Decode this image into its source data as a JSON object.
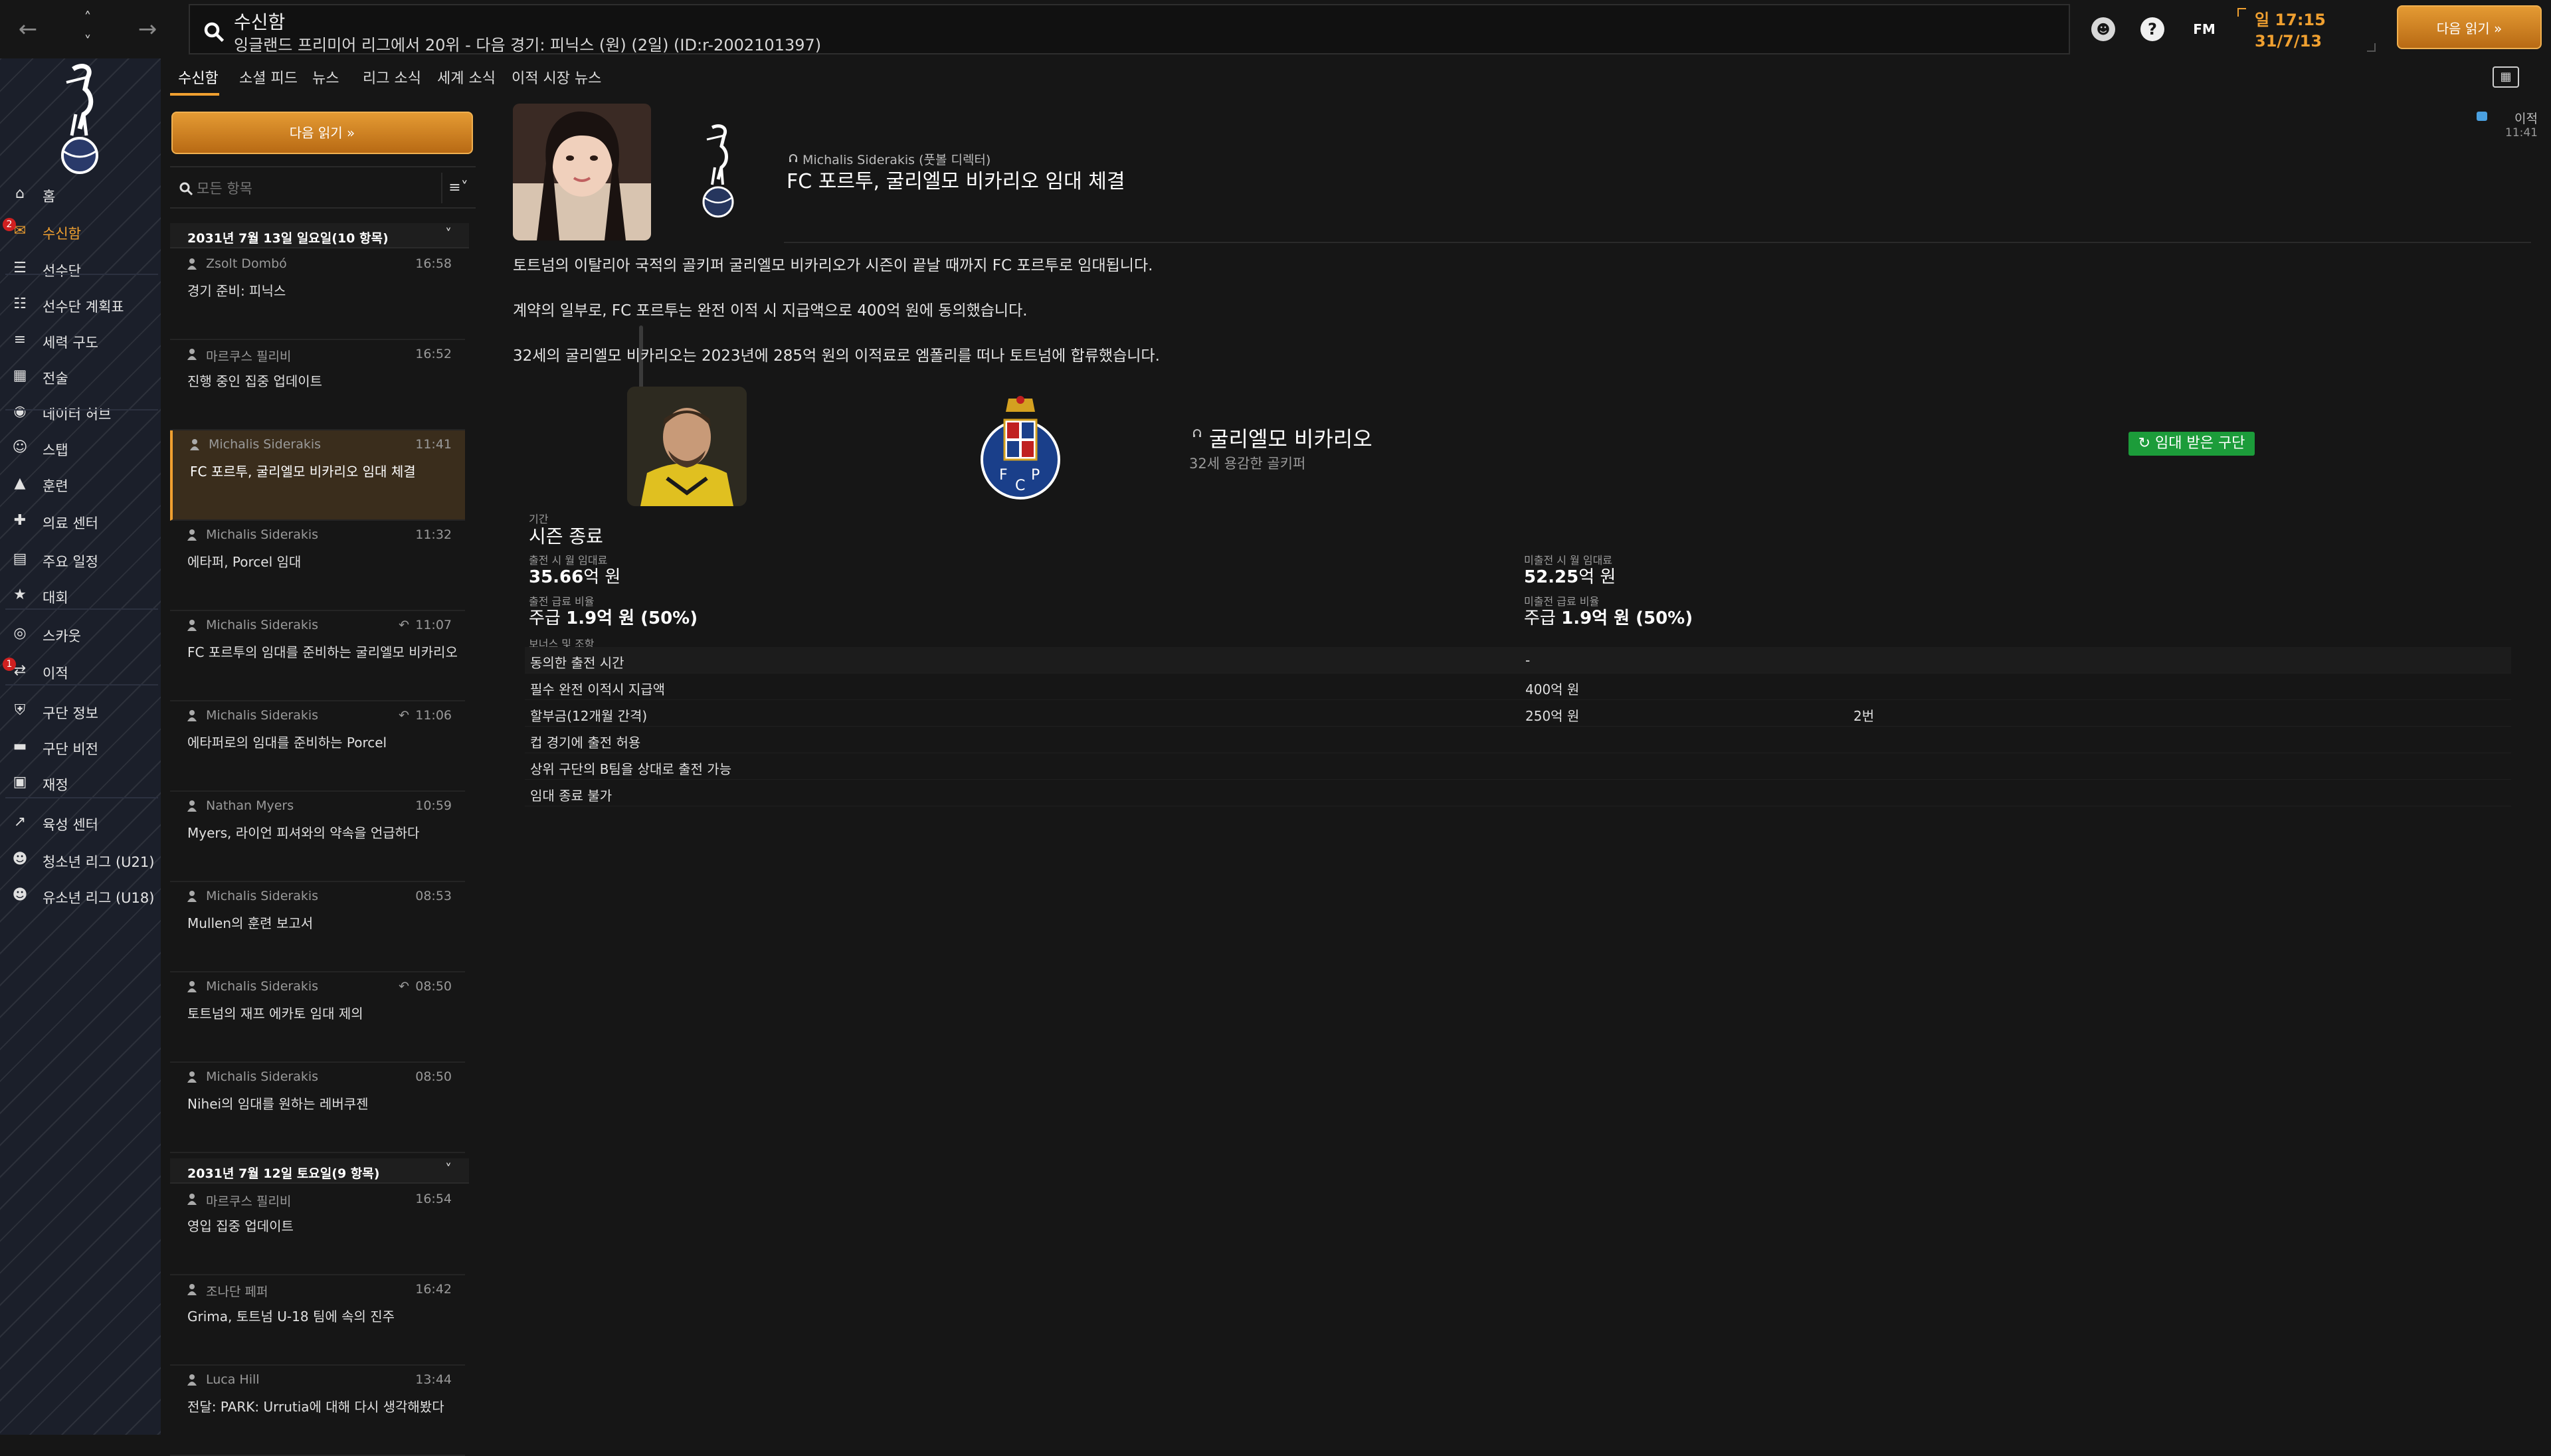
{
  "topbar": {
    "title": "수신함",
    "subtitle": "잉글랜드 프리미어 리그에서 20위 - 다음 경기: 피닉스 (원) (2일) (ID:r-2002101397)",
    "time": "일 17:15",
    "date": "31/7/13",
    "next_label": "다음 읽기 »",
    "fm_label": "FM",
    "help_label": "?"
  },
  "sidebar": {
    "items": [
      {
        "label": "홈",
        "icon": "home-icon"
      },
      {
        "label": "수신함",
        "icon": "inbox-icon",
        "badge": "2"
      },
      {
        "label": "선수단",
        "icon": "shirt-icon"
      },
      {
        "label": "선수단 계획표",
        "icon": "clipboard-icon"
      },
      {
        "label": "세력 구도",
        "icon": "hierarchy-icon"
      },
      {
        "label": "전술",
        "icon": "tactics-icon"
      },
      {
        "label": "데이터 허브",
        "icon": "data-hub-icon"
      },
      {
        "label": "스탭",
        "icon": "staff-icon"
      },
      {
        "label": "훈련",
        "icon": "training-icon"
      },
      {
        "label": "의료 센터",
        "icon": "medical-icon"
      },
      {
        "label": "주요 일정",
        "icon": "calendar-icon"
      },
      {
        "label": "대회",
        "icon": "trophy-icon"
      },
      {
        "label": "스카웃",
        "icon": "scout-icon"
      },
      {
        "label": "이적",
        "icon": "transfer-icon",
        "badge": "1"
      },
      {
        "label": "구단 정보",
        "icon": "club-info-icon"
      },
      {
        "label": "구단 비전",
        "icon": "club-vision-icon"
      },
      {
        "label": "재정",
        "icon": "finance-icon"
      },
      {
        "label": "육성 센터",
        "icon": "development-icon"
      },
      {
        "label": "청소년 리그 (U21)",
        "icon": "u21-icon"
      },
      {
        "label": "유소년 리그 (U18)",
        "icon": "u18-icon"
      }
    ]
  },
  "tabs": [
    "수신함",
    "소셜 피드",
    "뉴스",
    "리그 소식",
    "세계 소식",
    "이적 시장 뉴스"
  ],
  "list": {
    "next_label": "다음 읽기 »",
    "search_placeholder": "모든 항목",
    "groups": [
      {
        "title": "2031년 7월 13일 일요일(10 항목)"
      },
      {
        "title": "2031년 7월 12일 토요일(9 항목)"
      }
    ],
    "messages": [
      {
        "from": "Zsolt Dombó",
        "time": "16:58",
        "subject": "경기 준비: 피닉스",
        "reply": ""
      },
      {
        "from": "마르쿠스 필리비",
        "time": "16:52",
        "subject": "진행 중인 집중 업데이트",
        "reply": ""
      },
      {
        "from": "Michalis Siderakis",
        "time": "11:41",
        "subject": "FC 포르투, 굴리엘모 비카리오 임대 체결",
        "reply": ""
      },
      {
        "from": "Michalis Siderakis",
        "time": "11:32",
        "subject": "에타퍼, Porcel 임대",
        "reply": ""
      },
      {
        "from": "Michalis Siderakis",
        "time": "11:07",
        "subject": "FC 포르투의 임대를 준비하는 굴리엘모 비카리오",
        "reply": "↶"
      },
      {
        "from": "Michalis Siderakis",
        "time": "11:06",
        "subject": "에타퍼로의 임대를 준비하는 Porcel",
        "reply": "↶"
      },
      {
        "from": "Nathan Myers",
        "time": "10:59",
        "subject": "Myers, 라이언 피셔와의 약속을 언급하다",
        "reply": ""
      },
      {
        "from": "Michalis Siderakis",
        "time": "08:53",
        "subject": "Mullen의 훈련 보고서",
        "reply": ""
      },
      {
        "from": "Michalis Siderakis",
        "time": "08:50",
        "subject": "토트넘의 재프 에카토 임대 제의",
        "reply": "↶"
      },
      {
        "from": "Michalis Siderakis",
        "time": "08:50",
        "subject": "Nihei의 임대를 원하는 레버쿠젠",
        "reply": ""
      },
      {
        "from": "마르쿠스 필리비",
        "time": "16:54",
        "subject": "영입 집중 업데이트",
        "reply": ""
      },
      {
        "from": "조나단 페퍼",
        "time": "16:42",
        "subject": "Grima, 토트넘 U-18 팀에 속의 진주",
        "reply": ""
      },
      {
        "from": "Luca Hill",
        "time": "13:44",
        "subject": "전달: PARK: Urrutia에 대해 다시 생각해봤다",
        "reply": ""
      }
    ]
  },
  "article": {
    "sender": "Michalis Siderakis (풋볼 디렉터)",
    "title": "FC 포르투, 굴리엘모 비카리오 임대 체결",
    "tag": "이적",
    "tag_time": "11:41",
    "paragraphs": [
      "토트넘의 이탈리아 국적의 골키퍼 굴리엘모 비카리오가 시즌이 끝날 때까지 FC 포르투로 임대됩니다.",
      "계약의 일부로, FC 포르투는 완전 이적 시 지급액으로 400억 원에 동의했습니다.",
      "32세의 굴리엘모 비카리오는 2023년에 285억 원의 이적료로 엠폴리를 떠나 토트넘에 합류했습니다."
    ],
    "player_name": "굴리엘모 비카리오",
    "player_desc": "32세 용감한 골키퍼",
    "loan_badge": "임대 받은 구단",
    "period_label": "기간",
    "period_value": "시즌 종료",
    "wage_play_label": "출전 시 월 임대료",
    "wage_play_value": "35.66",
    "wage_play_unit": "억 원",
    "wage_noplay_label": "미출전 시 월 임대료",
    "wage_noplay_value": "52.25",
    "wage_noplay_unit": "억 원",
    "wage_share_play_label": "출전 급료 비율",
    "wage_share_play_pre": "주급 ",
    "wage_share_play_value": "1.9",
    "wage_share_play_post": "억 원 (50%)",
    "wage_share_noplay_label": "미출전 급료 비율",
    "wage_share_noplay_pre": "주급 ",
    "wage_share_noplay_value": "1.9",
    "wage_share_noplay_post": "억 원 (50%)",
    "bonus_label": "보너스 및 조항",
    "clauses": [
      {
        "name": "동의한 출전 시간",
        "value": "-",
        "extra": ""
      },
      {
        "name": "필수 완전 이적시 지급액",
        "value": "400억 원",
        "extra": ""
      },
      {
        "name": "할부금(12개월 간격)",
        "value": "250억 원",
        "extra": "2번"
      },
      {
        "name": "컵 경기에 출전 허용",
        "value": "",
        "extra": ""
      },
      {
        "name": "상위 구단의 B팀을 상대로 출전 가능",
        "value": "",
        "extra": ""
      },
      {
        "name": "임대 종료 불가",
        "value": "",
        "extra": ""
      }
    ]
  },
  "colors": {
    "accent": "#f0a030",
    "background": "#161616",
    "sidebar": "#1b1f2a",
    "loan_badge": "#1c9c3a",
    "badge_red": "#d02020"
  }
}
